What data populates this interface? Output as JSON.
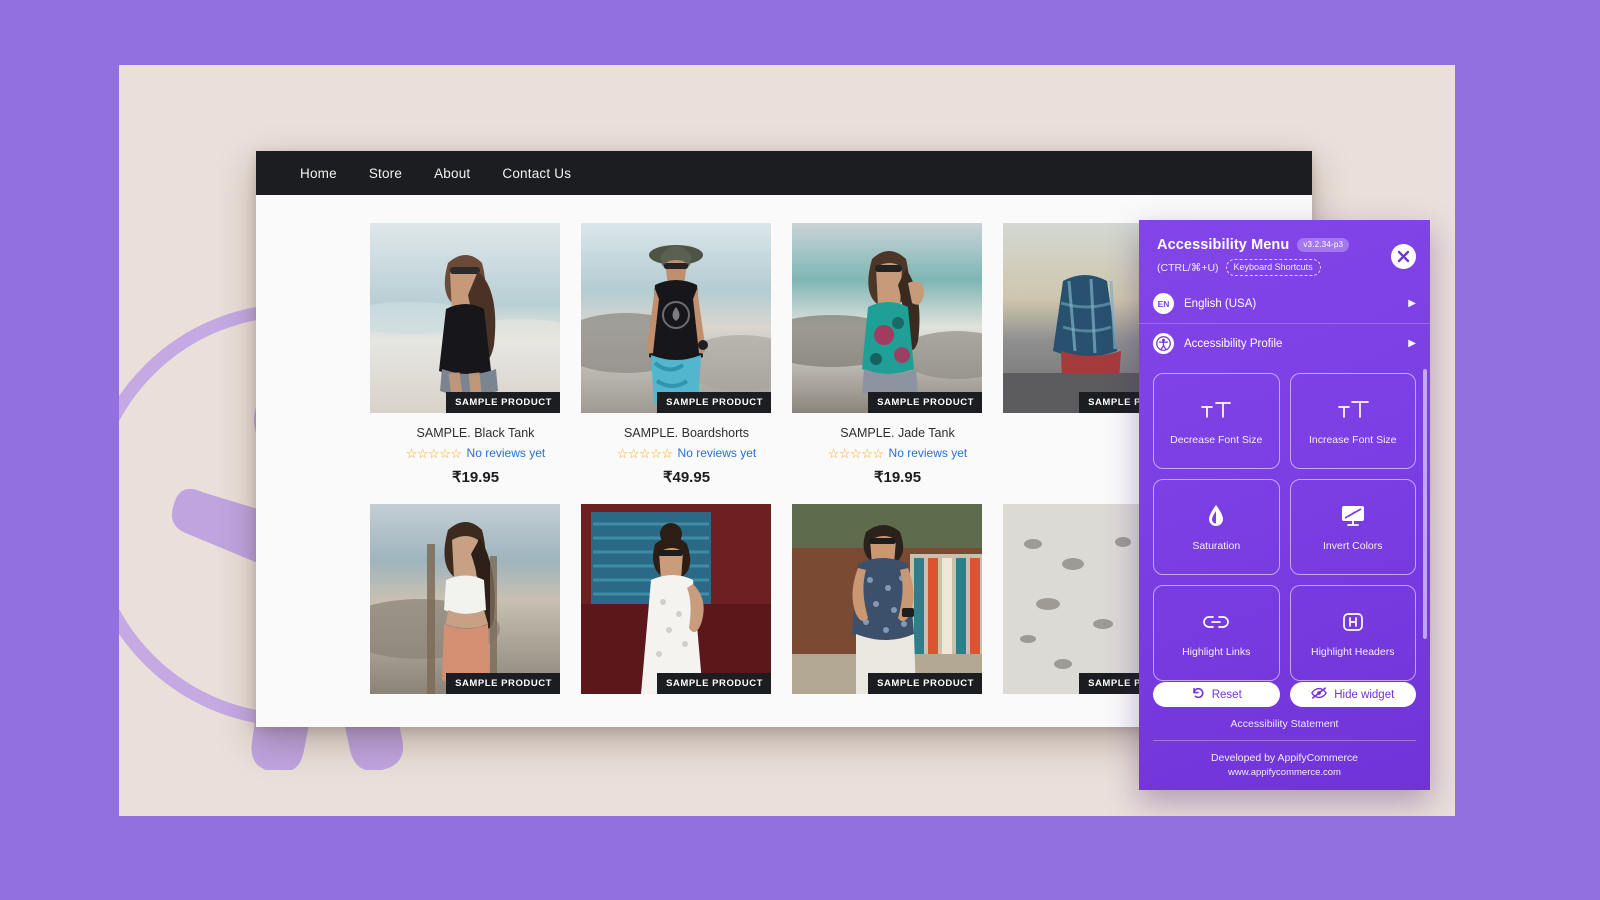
{
  "theme": {
    "page_bg": "#9370E0",
    "card_bg": "#EADFD9",
    "panel_purple": "#7B3FE4",
    "nav_bg": "#1C1D20",
    "star_color": "#F5A623",
    "link_color": "#2B6FD4"
  },
  "site": {
    "nav": [
      {
        "label": "Home"
      },
      {
        "label": "Store"
      },
      {
        "label": "About"
      },
      {
        "label": "Contact Us"
      }
    ],
    "badge_text": "SAMPLE PRODUCT",
    "products": [
      {
        "title": "SAMPLE. Black Tank",
        "reviews": "No reviews yet",
        "stars": "☆☆☆☆☆",
        "price": "₹19.95",
        "image": "woman-black-tank-beach"
      },
      {
        "title": "SAMPLE. Boardshorts",
        "reviews": "No reviews yet",
        "stars": "☆☆☆☆☆",
        "price": "₹49.95",
        "image": "man-black-tank-boardshorts-beach"
      },
      {
        "title": "SAMPLE. Jade Tank",
        "reviews": "No reviews yet",
        "stars": "☆☆☆☆☆",
        "price": "₹19.95",
        "image": "woman-jade-floral-tank-beach"
      },
      {
        "title": "",
        "reviews": "",
        "stars": "",
        "price": "",
        "image": "person-plaid-beach-partially-hidden"
      },
      {
        "title": "",
        "reviews": "",
        "stars": "",
        "price": "",
        "image": "woman-white-crop-top-beach"
      },
      {
        "title": "",
        "reviews": "",
        "stars": "",
        "price": "",
        "image": "woman-white-dress-van"
      },
      {
        "title": "",
        "reviews": "",
        "stars": "",
        "price": "",
        "image": "man-patterned-shirt-van"
      },
      {
        "title": "",
        "reviews": "",
        "stars": "",
        "price": "",
        "image": "beach-pebbles-partially-hidden"
      }
    ]
  },
  "panel": {
    "title": "Accessibility Menu",
    "version": "v3.2.34-p3",
    "shortcut_text": "(CTRL/⌘+U)",
    "shortcut_pill": "Keyboard Shortcuts",
    "close_icon": "close-icon",
    "rows": [
      {
        "badge": "EN",
        "label": "English (USA)",
        "arrow": "▶",
        "icon": "language-icon"
      },
      {
        "badge": "",
        "label": "Accessibility Profile",
        "arrow": "▶",
        "icon": "accessibility-person-icon"
      }
    ],
    "features": [
      {
        "label": "Decrease Font Size",
        "icon": "decrease-font-size-icon"
      },
      {
        "label": "Increase Font Size",
        "icon": "increase-font-size-icon"
      },
      {
        "label": "Saturation",
        "icon": "droplet-icon"
      },
      {
        "label": "Invert Colors",
        "icon": "monitor-invert-icon"
      },
      {
        "label": "Highlight Links",
        "icon": "link-icon"
      },
      {
        "label": "Highlight Headers",
        "icon": "header-h-icon"
      }
    ],
    "footer": {
      "reset_label": "Reset",
      "reset_icon": "reset-arrow-icon",
      "hide_label": "Hide widget",
      "hide_icon": "eye-slash-icon",
      "statement": "Accessibility Statement",
      "developer": "Developed by AppifyCommerce",
      "url": "www.appifycommerce.com"
    }
  }
}
